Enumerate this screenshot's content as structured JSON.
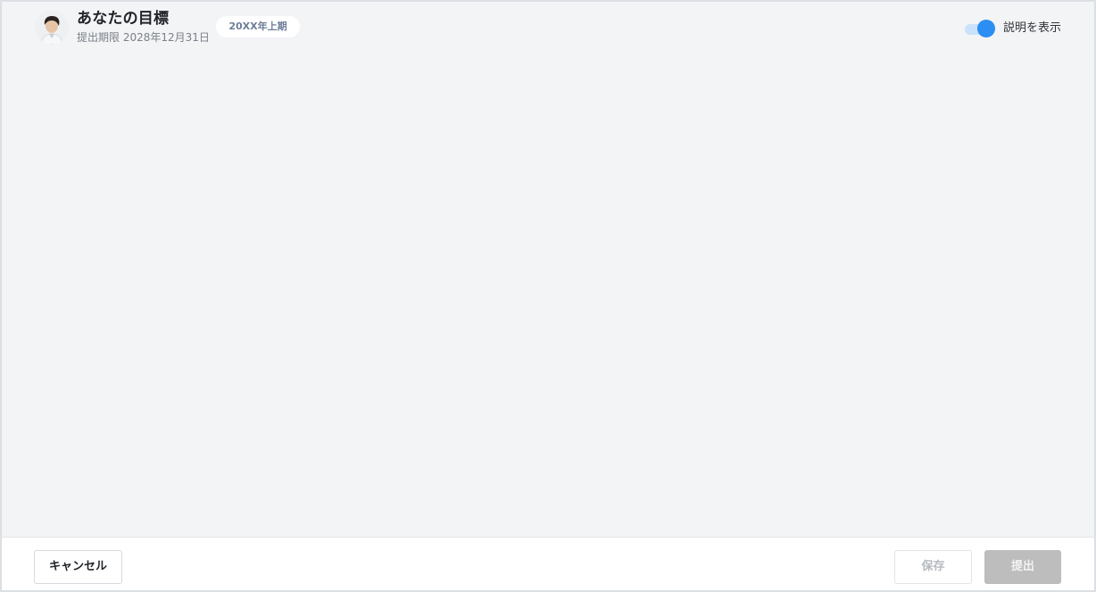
{
  "header": {
    "title": "あなたの目標",
    "deadline": "提出期限 2028年12月31日",
    "period_badge": "20XX年上期",
    "avatar_icon": "user-avatar",
    "toggle": {
      "label": "説明を表示",
      "on": true,
      "on_color": "#2b8ef2"
    }
  },
  "footer": {
    "cancel_label": "キャンセル",
    "save_label": "保存",
    "submit_label": "提出"
  }
}
